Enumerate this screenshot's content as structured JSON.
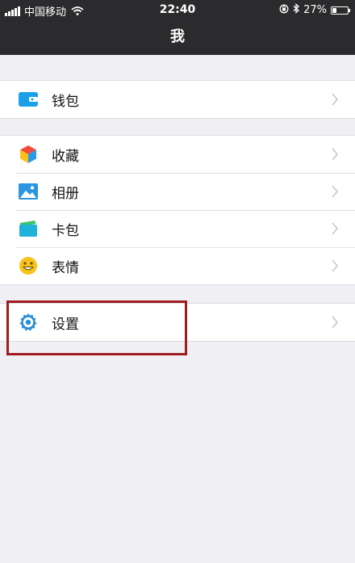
{
  "status_bar": {
    "carrier": "中国移动",
    "time": "22:40",
    "battery_percent": "27%",
    "battery_level": 0.27,
    "icons": [
      "signal-icon",
      "wifi-icon",
      "orientation-lock-icon",
      "bluetooth-icon",
      "battery-icon"
    ]
  },
  "nav": {
    "title": "我"
  },
  "groups": [
    {
      "items": [
        {
          "label": "钱包",
          "icon": "wallet-icon",
          "icon_color": "#1aa0e8"
        }
      ]
    },
    {
      "items": [
        {
          "label": "收藏",
          "icon": "favorites-cube-icon",
          "icon_color": "#e8443a"
        },
        {
          "label": "相册",
          "icon": "album-icon",
          "icon_color": "#2a95e0"
        },
        {
          "label": "卡包",
          "icon": "card-pack-icon",
          "icon_color": "#1fb3d9"
        },
        {
          "label": "表情",
          "icon": "smiley-icon",
          "icon_color": "#f7c21a"
        }
      ]
    },
    {
      "items": [
        {
          "label": "设置",
          "icon": "gear-icon",
          "icon_color": "#2a8fd6"
        }
      ]
    }
  ],
  "highlight_color": "#a01c1f"
}
